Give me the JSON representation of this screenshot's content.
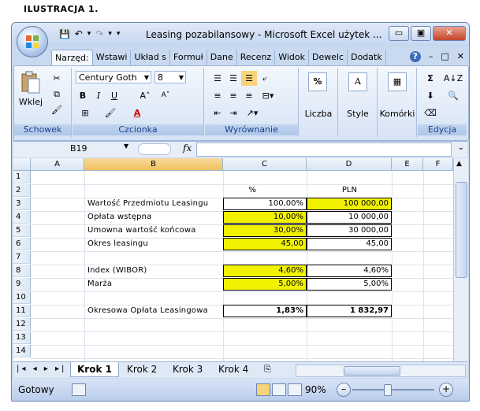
{
  "caption": "ILUSTRACJA 1.",
  "window": {
    "title": "Leasing pozabilansowy - Microsoft Excel użytek ...",
    "controls": {
      "minimize": "▭",
      "maximize": "▣",
      "close": "✕"
    }
  },
  "qat": {
    "save": "💾",
    "undo": "↶",
    "undo_arrow": "▾",
    "redo": "↷",
    "redo_arrow": "▾",
    "customize": "▾"
  },
  "tabs": [
    "Narzęd:",
    "Wstawi",
    "Układ s",
    "Formuł",
    "Dane",
    "Recenz",
    "Widok",
    "Dewelc",
    "Dodatk"
  ],
  "tabs_right": {
    "help": "?",
    "min": "–",
    "restore": "□",
    "close": "✕"
  },
  "ribbon": {
    "clipboard": {
      "paste": "Wklej",
      "label": "Schowek"
    },
    "font": {
      "name": "Century Goth",
      "size": "8",
      "bold": "B",
      "italic": "I",
      "underline": "U",
      "grow": "A˄",
      "shrink": "A˅",
      "border": "⊞",
      "fill": "🖌",
      "color": "A",
      "label": "Czcionka"
    },
    "alignment": {
      "label": "Wyrównanie"
    },
    "number": {
      "symbol": "%",
      "label": "Liczba"
    },
    "styles": {
      "label": "Style"
    },
    "cells": {
      "label": "Komórki"
    },
    "editing": {
      "sum": "Σ",
      "sort": "A↓Z",
      "find": "🔍",
      "label": "Edycja"
    }
  },
  "formula_bar": {
    "name_box": "B19",
    "fx": "fx",
    "value": ""
  },
  "columns": [
    "A",
    "B",
    "C",
    "D",
    "E",
    "F"
  ],
  "rows": [
    "1",
    "2",
    "3",
    "4",
    "5",
    "6",
    "7",
    "8",
    "9",
    "10",
    "11",
    "12",
    "13",
    "14"
  ],
  "sheet": {
    "header_pct": "%",
    "header_pln": "PLN",
    "labels": {
      "r3": "Wartość Przedmiotu Leasingu",
      "r4": "Opłata wstępna",
      "r5": "Umowna wartość końcowa",
      "r6": "Okres leasingu",
      "r8": "Index (WIBOR)",
      "r9": "Marża",
      "r11": "Okresowa Opłata Leasingowa"
    },
    "values": {
      "c3": "100,00%",
      "d3": "100 000,00",
      "c4": "10,00%",
      "d4": "10 000,00",
      "c5": "30,00%",
      "d5": "30 000,00",
      "c6": "45,00",
      "d6": "45,00",
      "c8": "4,60%",
      "d8": "4,60%",
      "c9": "5,00%",
      "d9": "5,00%",
      "c11": "1,83%",
      "d11": "1 832,97"
    }
  },
  "sheet_tabs": [
    "Krok 1",
    "Krok 2",
    "Krok 3",
    "Krok 4"
  ],
  "status": {
    "ready": "Gotowy",
    "zoom": "90%",
    "minus": "–",
    "plus": "+"
  },
  "colors": {
    "yellow": "#f2f200",
    "accent": "#15428b"
  }
}
